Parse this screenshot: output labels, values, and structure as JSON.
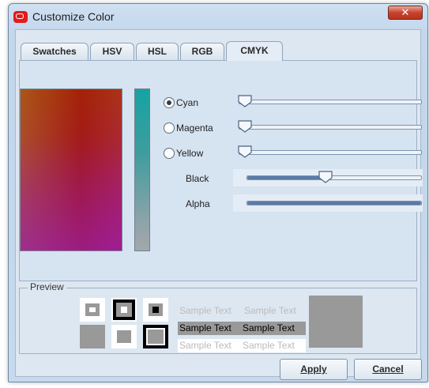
{
  "window": {
    "title": "Customize Color",
    "close_glyph": "✕"
  },
  "tabs": [
    {
      "label": "Swatches",
      "active": false
    },
    {
      "label": "HSV",
      "active": false
    },
    {
      "label": "HSL",
      "active": false
    },
    {
      "label": "RGB",
      "active": false
    },
    {
      "label": "CMYK",
      "active": true
    }
  ],
  "cmyk": {
    "rows": [
      {
        "label": "Cyan",
        "selected": true,
        "has_radio": true,
        "value_fraction": 0.0
      },
      {
        "label": "Magenta",
        "selected": false,
        "has_radio": true,
        "value_fraction": 0.0
      },
      {
        "label": "Yellow",
        "selected": false,
        "has_radio": true,
        "value_fraction": 0.0
      },
      {
        "label": "Black",
        "selected": false,
        "has_radio": false,
        "value_fraction": 0.45
      },
      {
        "label": "Alpha",
        "selected": false,
        "has_radio": false,
        "value_fraction": 1.0
      }
    ]
  },
  "preview": {
    "label": "Preview",
    "sample_text": "Sample Text",
    "preview_color": "#999999"
  },
  "buttons": {
    "apply": "Apply",
    "cancel": "Cancel"
  },
  "icons": {
    "app": "oracle-icon",
    "close": "close-icon",
    "thumb": "slider-thumb-icon"
  }
}
